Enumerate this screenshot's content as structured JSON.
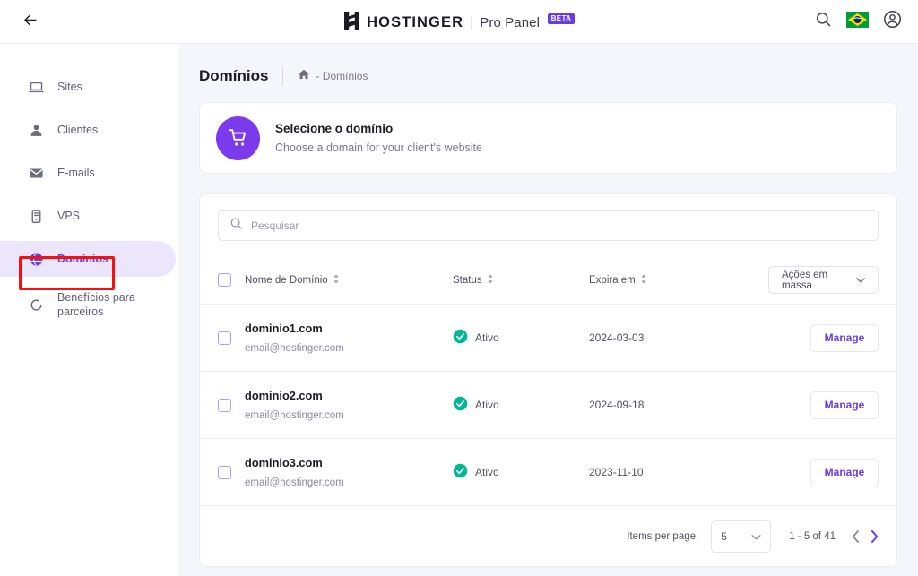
{
  "topbar": {
    "back_icon": "arrow-left-icon",
    "brand_name": "HOSTINGER",
    "brand_separator": "|",
    "brand_sub": "Pro Panel",
    "beta": "BETA",
    "search_icon": "search-icon",
    "flag": "brazil-flag-icon",
    "account_icon": "user-account-icon"
  },
  "sidebar": {
    "items": [
      {
        "label": "Sites",
        "icon": "laptop-icon",
        "active": false
      },
      {
        "label": "Clientes",
        "icon": "person-icon",
        "active": false
      },
      {
        "label": "E-mails",
        "icon": "envelope-icon",
        "active": false
      },
      {
        "label": "VPS",
        "icon": "server-icon",
        "active": false
      },
      {
        "label": "Domínios",
        "icon": "globe-icon",
        "active": true
      },
      {
        "label": "Benefícios para parceiros",
        "icon": "loop-circle-icon",
        "active": false
      }
    ],
    "active_highlight_color": "#ece6fc",
    "active_text_color": "#673de6",
    "annotation_color": "#fa0f0f"
  },
  "page": {
    "title": "Domínios",
    "breadcrumb_home_icon": "home-icon",
    "breadcrumb_text": "- Domínios"
  },
  "banner": {
    "icon": "shopping-cart-icon",
    "icon_bg": "#7c3aed",
    "title": "Selecione o domínio",
    "subtitle": "Choose a domain for your client's website"
  },
  "search": {
    "icon": "search-icon",
    "placeholder": "Pesquisar",
    "value": ""
  },
  "table": {
    "columns": [
      {
        "label": "Nome de Domínio",
        "sortable": true
      },
      {
        "label": "Status",
        "sortable": true
      },
      {
        "label": "Expira em",
        "sortable": true
      }
    ],
    "bulk_actions_label": "Ações em massa",
    "bulk_actions_chevron": "chevron-down-icon",
    "select_all_checked": false,
    "rows": [
      {
        "checked": false,
        "domain": "dominio1.com",
        "email": "email@hostinger.com",
        "status": "Ativo",
        "status_icon": "check-circle-icon",
        "status_color": "#00b894",
        "expires": "2024-03-03",
        "action_label": "Manage"
      },
      {
        "checked": false,
        "domain": "dominio2.com",
        "email": "email@hostinger.com",
        "status": "Ativo",
        "status_icon": "check-circle-icon",
        "status_color": "#00b894",
        "expires": "2024-09-18",
        "action_label": "Manage"
      },
      {
        "checked": false,
        "domain": "dominio3.com",
        "email": "email@hostinger.com",
        "status": "Ativo",
        "status_icon": "check-circle-icon",
        "status_color": "#00b894",
        "expires": "2023-11-10",
        "action_label": "Manage"
      }
    ]
  },
  "pagination": {
    "items_per_page_label": "Items per page:",
    "items_per_page_value": "5",
    "select_chevron": "chevron-down-icon",
    "range_text": "1 - 5 of 41",
    "prev_icon": "chevron-left-icon",
    "next_icon": "chevron-right-icon",
    "prev_color": "#8b8b9d",
    "next_color": "#673de6"
  }
}
